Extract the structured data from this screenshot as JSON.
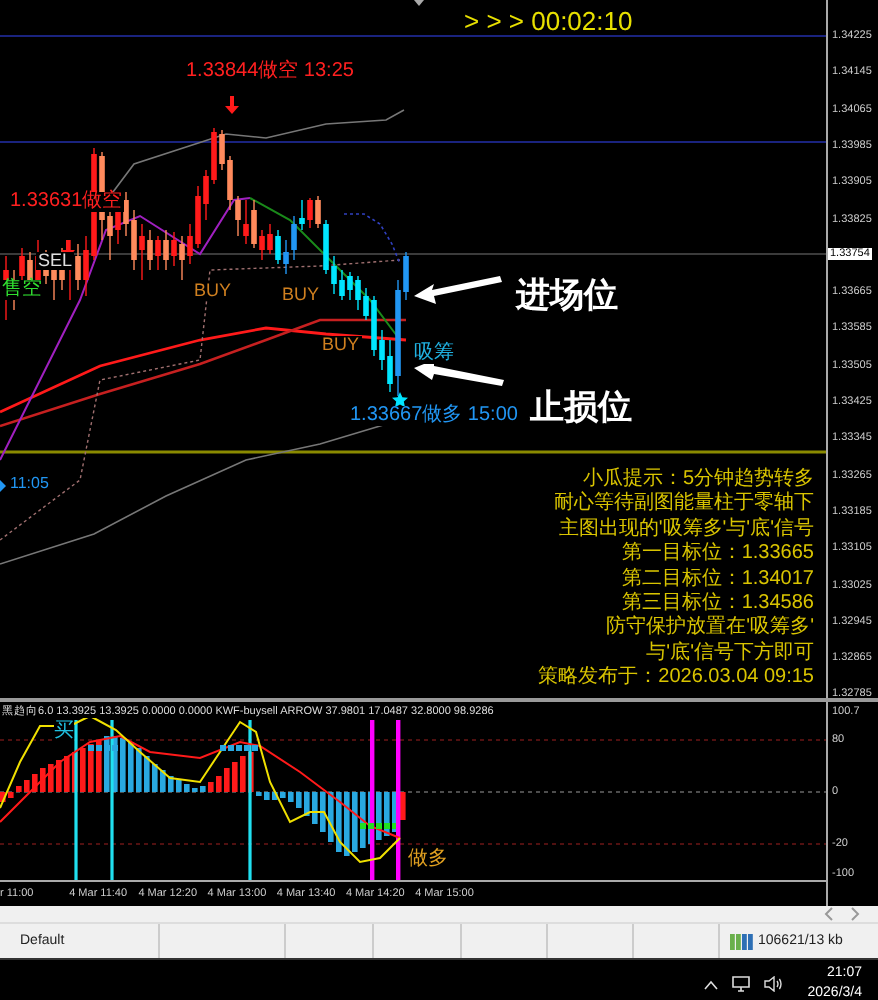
{
  "timer": "> > > 00:02:10",
  "chart_labels": [
    {
      "text": "1.33844做空 13:25",
      "kind": "sell"
    },
    {
      "text": "1.33631做空",
      "kind": "sell"
    },
    {
      "text": "售空",
      "kind": "green"
    },
    {
      "text": "SEL",
      "kind": "plain"
    },
    {
      "text": "BUY",
      "kind": "buy"
    },
    {
      "text": "BUY",
      "kind": "buy"
    },
    {
      "text": "BUY",
      "kind": "buy"
    },
    {
      "text": "吸筹",
      "kind": "absorb"
    },
    {
      "text": "1.33667做多 15:00",
      "kind": "long"
    },
    {
      "text": "11:05",
      "kind": "long"
    }
  ],
  "annotations": [
    {
      "text": "进场位"
    },
    {
      "text": "止损位"
    }
  ],
  "strategy_note": [
    "小瓜提示：5分钟趋势转多",
    "耐心等待副图能量柱于零轴下",
    "主图出现的'吸筹多'与'底'信号",
    "第一目标位：1.33665",
    "第二目标位：1.34017",
    "第三目标位：1.34586",
    "防守保护放置在'吸筹多'",
    "与'底'信号下方即可",
    "策略发布于：2026.03.04 09:15"
  ],
  "price_axis": {
    "ticks": [
      "1.34225",
      "1.34145",
      "1.34065",
      "1.33985",
      "1.33905",
      "1.33825",
      "1.33665",
      "1.33585",
      "1.33505",
      "1.33425",
      "1.33345",
      "1.33265",
      "1.33185",
      "1.33105",
      "1.33025",
      "1.32945",
      "1.32865",
      "1.32785"
    ],
    "current": "1.33754"
  },
  "indicator": {
    "header": "黑趋向6.0 13.3925 13.3925 0.0000 0.0000  KWF-buysell ARROW 37.9801 17.0487 32.8000 98.9286",
    "ticks": [
      "100.7",
      "80",
      "0",
      "-20",
      "-100"
    ],
    "labels": [
      {
        "text": "买",
        "kind": "buy"
      },
      {
        "text": "做多",
        "kind": "long"
      }
    ]
  },
  "time_axis": [
    "r 11:00",
    "4 Mar 11:40",
    "4 Mar 12:20",
    "4 Mar 13:00",
    "4 Mar 13:40",
    "4 Mar 14:20",
    "4 Mar 15:00"
  ],
  "status_bar": {
    "profile": "Default",
    "traffic": "106621/13 kb"
  },
  "taskbar": {
    "time": "21:07",
    "date": "2026/3/4"
  }
}
